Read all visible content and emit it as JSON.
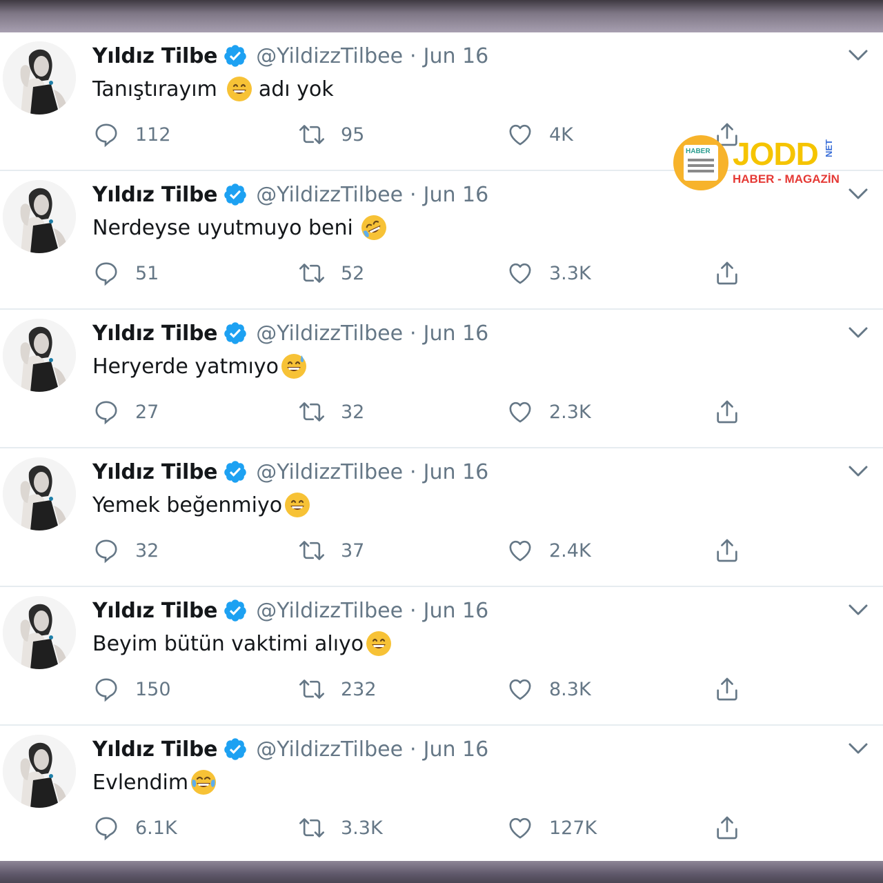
{
  "tweets": [
    {
      "name": "Yıldız Tilbe",
      "handle": "@YildizzTilbee",
      "separator": "·",
      "date": "Jun 16",
      "text_before": "Tanıştırayım",
      "emoji": "grinning-face-emoji",
      "text_after": "adı yok",
      "replies": "112",
      "retweets": "95",
      "likes": "4K"
    },
    {
      "name": "Yıldız Tilbe",
      "handle": "@YildizzTilbee",
      "separator": "·",
      "date": "Jun 16",
      "text_before": "Nerdeyse uyutmuyo beni",
      "emoji": "rolling-laughing-emoji",
      "text_after": "",
      "replies": "51",
      "retweets": "52",
      "likes": "3.3K"
    },
    {
      "name": "Yıldız Tilbe",
      "handle": "@YildizzTilbee",
      "separator": "·",
      "date": "Jun 16",
      "text_before": "Heryerde yatmıyo",
      "emoji": "sweat-smile-emoji",
      "text_after": "",
      "replies": "27",
      "retweets": "32",
      "likes": "2.3K"
    },
    {
      "name": "Yıldız Tilbe",
      "handle": "@YildizzTilbee",
      "separator": "·",
      "date": "Jun 16",
      "text_before": "Yemek beğenmiyo",
      "emoji": "grinning-face-emoji",
      "text_after": "",
      "replies": "32",
      "retweets": "37",
      "likes": "2.4K"
    },
    {
      "name": "Yıldız Tilbe",
      "handle": "@YildizzTilbee",
      "separator": "·",
      "date": "Jun 16",
      "text_before": "Beyim bütün vaktimi alıyo",
      "emoji": "grinning-face-emoji",
      "text_after": "",
      "replies": "150",
      "retweets": "232",
      "likes": "8.3K"
    },
    {
      "name": "Yıldız Tilbe",
      "handle": "@YildizzTilbee",
      "separator": "·",
      "date": "Jun 16",
      "text_before": "Evlendim",
      "emoji": "tears-of-joy-emoji",
      "text_after": "",
      "replies": "6.1K",
      "retweets": "3.3K",
      "likes": "127K"
    }
  ],
  "watermark": {
    "badge": "HABER",
    "brand": "JODD",
    "suffix": "NET",
    "tagline": "HABER - MAGAZİN"
  },
  "colors": {
    "verified": "#1da1f2",
    "secondary_text": "#657786",
    "primary_text": "#14171a",
    "divider": "#e6ecf0",
    "emoji_yellow": "#f7c236"
  }
}
